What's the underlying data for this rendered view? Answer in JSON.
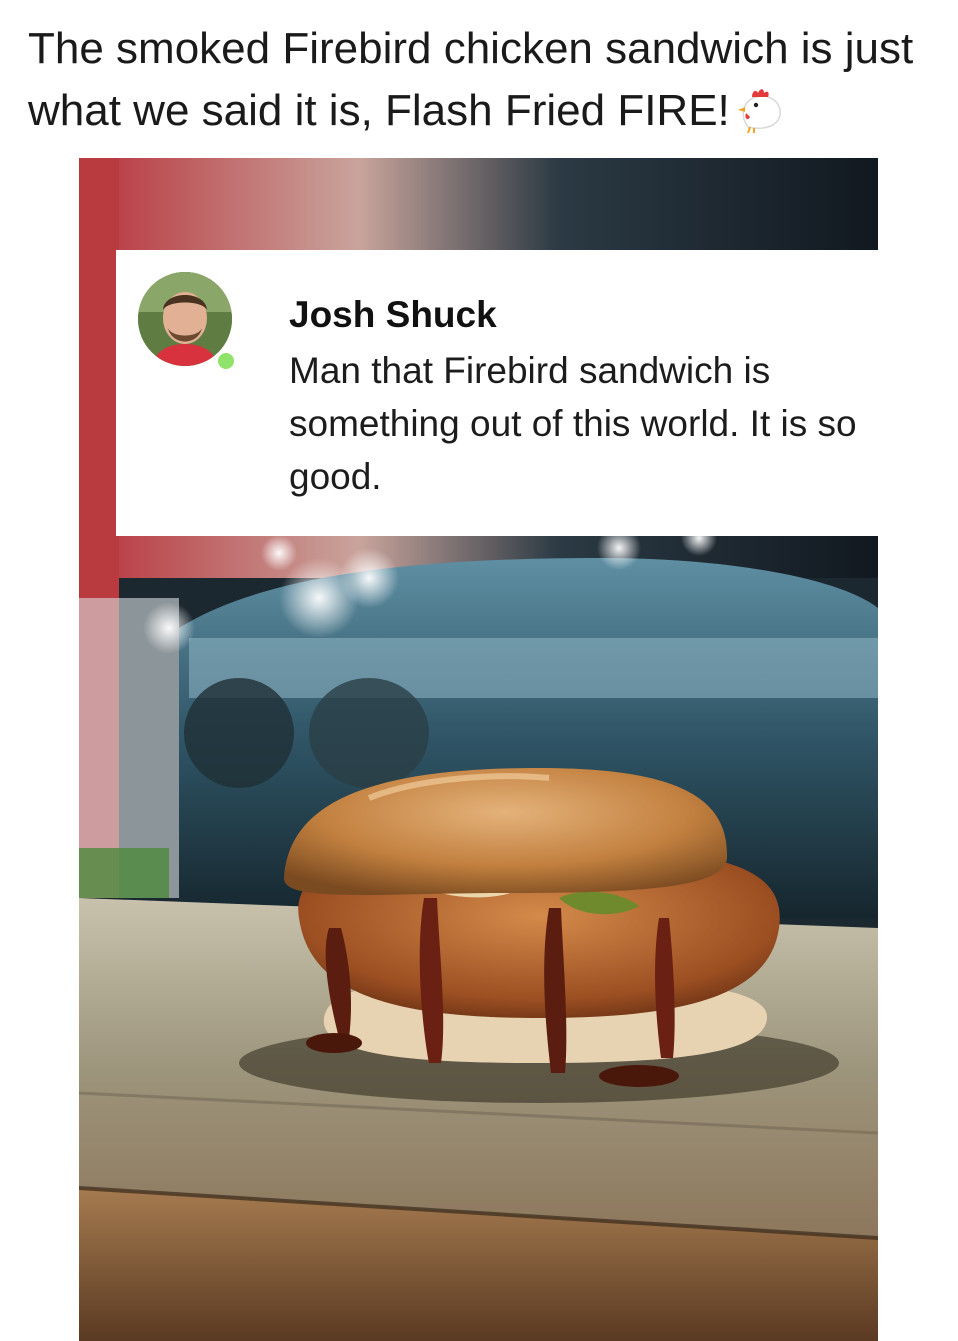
{
  "post": {
    "caption": "The smoked Firebird chicken sandwich is just what we said it is, Flash Fried FIRE!",
    "caption_icon": "rooster-icon"
  },
  "comment": {
    "author": "Josh Shuck",
    "text": "Man that Firebird sandwich is something out of this world. It is so good.",
    "online_status_color": "#8fe36a"
  },
  "photo": {
    "subject": "sandwich-photo"
  }
}
